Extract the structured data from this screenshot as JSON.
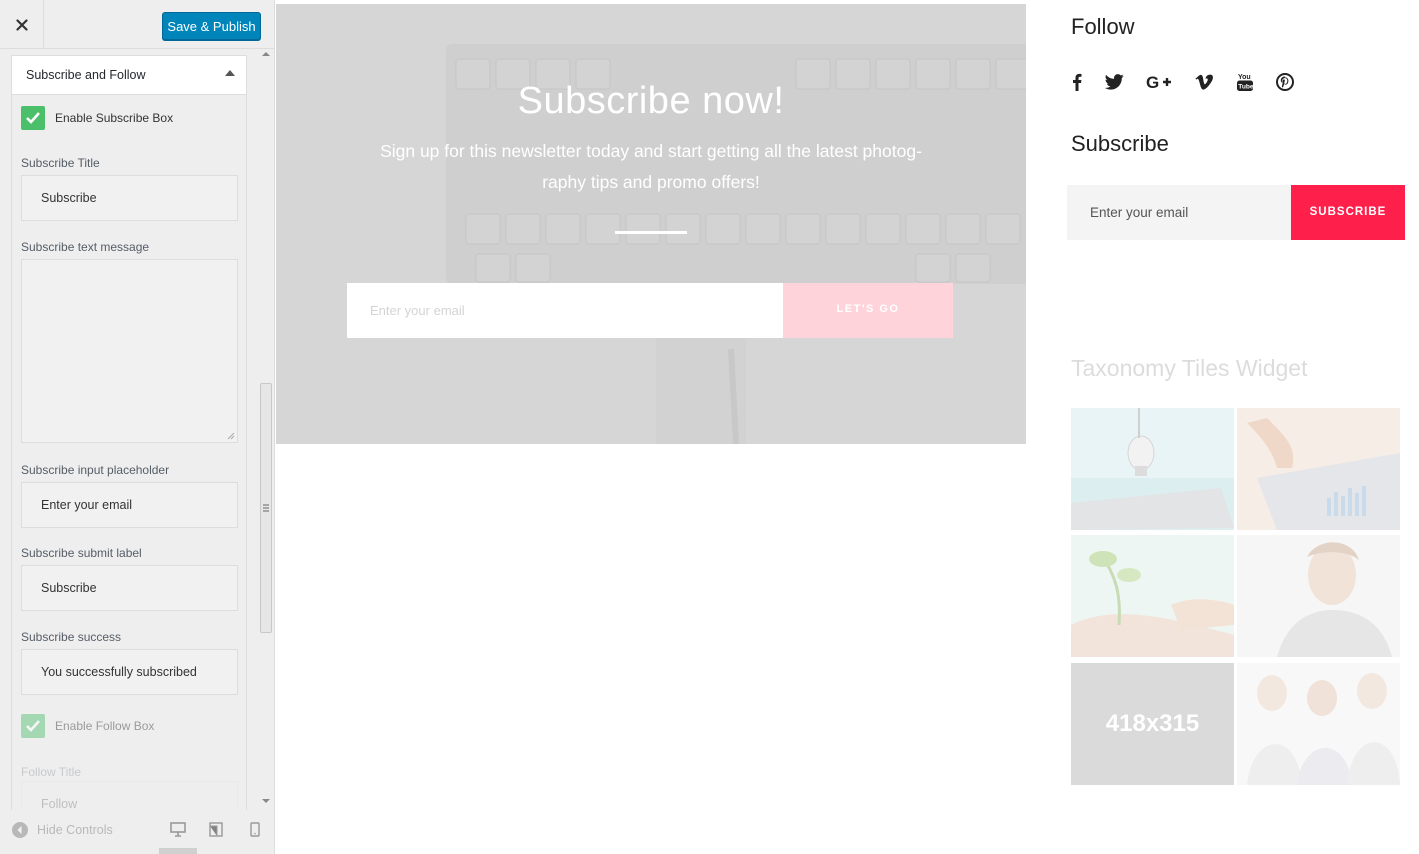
{
  "customizer": {
    "publish_label": "Save & Publish",
    "section_title": "Subscribe and Follow",
    "enable_subscribe_label": "Enable Subscribe Box",
    "subscribe_title_label": "Subscribe Title",
    "subscribe_title_value": "Subscribe",
    "subscribe_text_label": "Subscribe text message",
    "subscribe_text_value": "",
    "placeholder_label": "Subscribe input placeholder",
    "placeholder_value": "Enter your email",
    "submit_label_label": "Subscribe submit label",
    "submit_label_value": "Subscribe",
    "success_label": "Subscribe success",
    "success_value": "You successfully subscribed",
    "enable_follow_label": "Enable Follow Box",
    "follow_title_label": "Follow Title",
    "follow_title_value": "Follow",
    "hide_controls_label": "Hide Controls",
    "checkbox_color": "#4cbf6a",
    "publish_color": "#0085ba"
  },
  "hero": {
    "title": "Subscribe now!",
    "text": "Sign up for this newsletter today and start getting all the latest photog- raphy tips and promo offers!",
    "email_placeholder": "Enter your email",
    "button_label": "LET'S GO",
    "button_color": "#ffd3da"
  },
  "widgets": {
    "follow_title": "Follow",
    "social_icons": [
      "facebook-icon",
      "twitter-icon",
      "google-plus-icon",
      "vimeo-icon",
      "youtube-icon",
      "pinterest-icon"
    ],
    "subscribe_title": "Subscribe",
    "email_placeholder": "Enter your email",
    "subscribe_button": "SUBSCRIBE",
    "subscribe_button_color": "#ff1f4b",
    "taxonomy_title": "Taxonomy Tiles Widget",
    "tiles": [
      {
        "name": "lightbulb-tablet-photo"
      },
      {
        "name": "tablet-chart-photo"
      },
      {
        "name": "sprout-hands-photo"
      },
      {
        "name": "man-portrait-photo"
      },
      {
        "name": "placeholder-tile",
        "label": "418x315"
      },
      {
        "name": "business-team-photo"
      }
    ]
  }
}
